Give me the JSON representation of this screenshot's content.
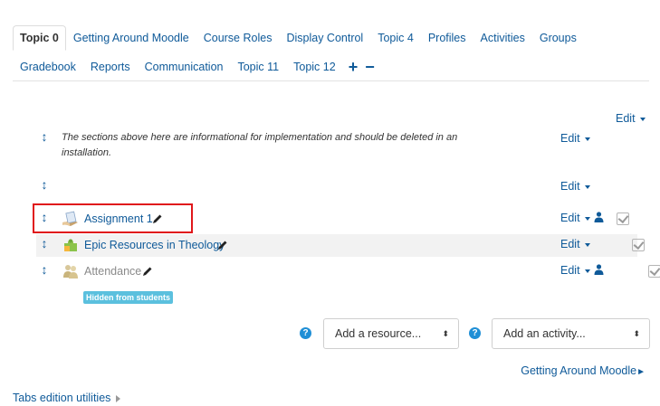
{
  "tabs": {
    "row1": [
      "Topic 0",
      "Getting Around Moodle",
      "Course Roles",
      "Display Control",
      "Topic 4",
      "Profiles",
      "Activities",
      "Groups"
    ],
    "row2": [
      "Gradebook",
      "Reports",
      "Communication",
      "Topic 11",
      "Topic 12"
    ],
    "add_symbol": "+",
    "remove_symbol": "−"
  },
  "section": {
    "edit_label": "Edit",
    "summary_text": "The sections above here are informational for implementation and should be deleted in an installation."
  },
  "activities": [
    {
      "name": "Assignment 1",
      "icon": "assignment-icon",
      "hidden": false
    },
    {
      "name": "Epic Resources in Theology",
      "icon": "puzzle-icon",
      "hidden": false
    },
    {
      "name": "Attendance",
      "icon": "attendance-icon",
      "hidden": true
    }
  ],
  "hidden_badge": "Hidden from students",
  "add_resource": {
    "selected": "Add a resource..."
  },
  "add_activity": {
    "selected": "Add an activity..."
  },
  "next_section": "Getting Around Moodle",
  "tabs_utilities": "Tabs edition utilities",
  "colors": {
    "link": "#0f5a99",
    "highlight": "#e0171b",
    "badge": "#5bc0de",
    "help": "#1f8fd6"
  }
}
